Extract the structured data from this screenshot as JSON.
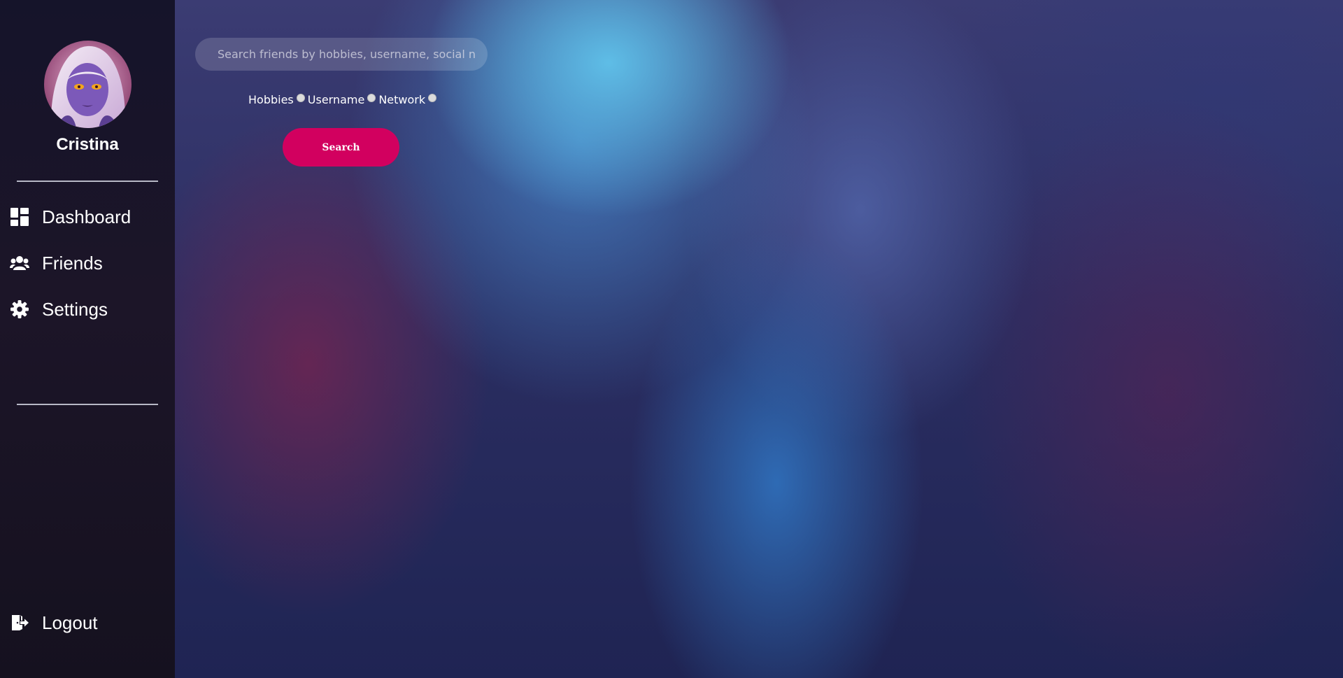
{
  "profile": {
    "name": "Cristina"
  },
  "nav": {
    "items": [
      {
        "label": "Dashboard",
        "icon": "dashboard-icon"
      },
      {
        "label": "Friends",
        "icon": "users-icon"
      },
      {
        "label": "Settings",
        "icon": "gear-icon"
      }
    ],
    "logout": {
      "label": "Logout",
      "icon": "logout-icon"
    }
  },
  "search": {
    "placeholder": "Search friends by hobbies, username, social network",
    "value": "",
    "filters": [
      {
        "label": "Hobbies",
        "checked": false
      },
      {
        "label": "Username",
        "checked": false
      },
      {
        "label": "Network",
        "checked": false
      }
    ],
    "button_label": "Search"
  },
  "colors": {
    "accent": "#d2005f",
    "sidebar_bg": "#16132a",
    "text": "#ffffff"
  }
}
